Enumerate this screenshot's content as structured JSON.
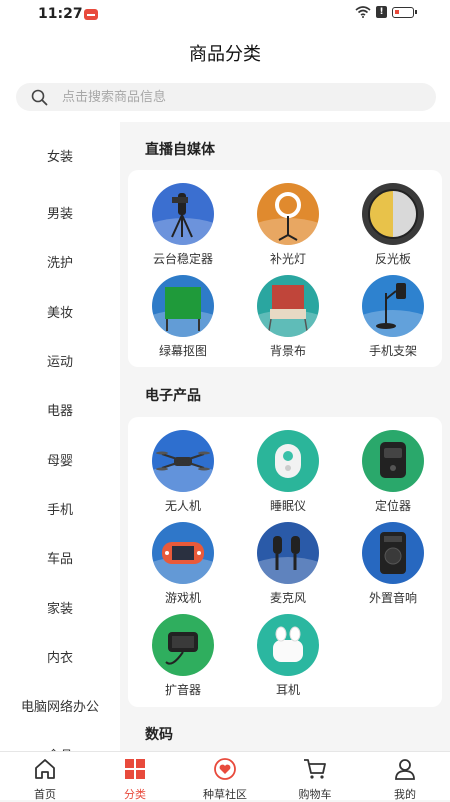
{
  "status": {
    "time": "11:27",
    "alert": "!"
  },
  "header": {
    "title": "商品分类"
  },
  "search": {
    "placeholder": "点击搜索商品信息"
  },
  "sidebar": {
    "items": [
      "女装",
      "男装",
      "洗护",
      "美妆",
      "运动",
      "电器",
      "母婴",
      "手机",
      "车品",
      "家装",
      "内衣",
      "电脑网络办公",
      "食品"
    ]
  },
  "sections": [
    {
      "title": "直播自媒体",
      "items": [
        {
          "label": "云台稳定器",
          "icon": "gimbal-icon",
          "bg": "#3b6fd0"
        },
        {
          "label": "补光灯",
          "icon": "ring-light-icon",
          "bg": "#e08a2e"
        },
        {
          "label": "反光板",
          "icon": "reflector-icon",
          "bg": "#3a3a3a"
        },
        {
          "label": "绿幕抠图",
          "icon": "green-screen-icon",
          "bg": "#2e7bc8"
        },
        {
          "label": "背景布",
          "icon": "backdrop-icon",
          "bg": "#2aa6a0"
        },
        {
          "label": "手机支架",
          "icon": "phone-stand-icon",
          "bg": "#2e82cf"
        }
      ]
    },
    {
      "title": "电子产品",
      "items": [
        {
          "label": "无人机",
          "icon": "drone-icon",
          "bg": "#2e6fcf"
        },
        {
          "label": "睡眠仪",
          "icon": "sleep-device-icon",
          "bg": "#2bb59a"
        },
        {
          "label": "定位器",
          "icon": "gps-tracker-icon",
          "bg": "#2aa86b"
        },
        {
          "label": "游戏机",
          "icon": "game-console-icon",
          "bg": "#2f77c9"
        },
        {
          "label": "麦克风",
          "icon": "microphone-icon",
          "bg": "#2a5aa8"
        },
        {
          "label": "外置音响",
          "icon": "speaker-icon",
          "bg": "#2768c0"
        },
        {
          "label": "扩音器",
          "icon": "megaphone-icon",
          "bg": "#2fae5e"
        },
        {
          "label": "耳机",
          "icon": "earbuds-icon",
          "bg": "#2bb7a0"
        }
      ]
    },
    {
      "title": "数码"
    }
  ],
  "tabbar": [
    {
      "label": "首页",
      "icon": "home-icon",
      "active": false
    },
    {
      "label": "分类",
      "icon": "category-icon",
      "active": true
    },
    {
      "label": "种草社区",
      "icon": "community-icon",
      "active": false
    },
    {
      "label": "购物车",
      "icon": "cart-icon",
      "active": false
    },
    {
      "label": "我的",
      "icon": "user-icon",
      "active": false
    }
  ],
  "colors": {
    "accent": "#e84a3c",
    "background": "#f5f5f5"
  }
}
